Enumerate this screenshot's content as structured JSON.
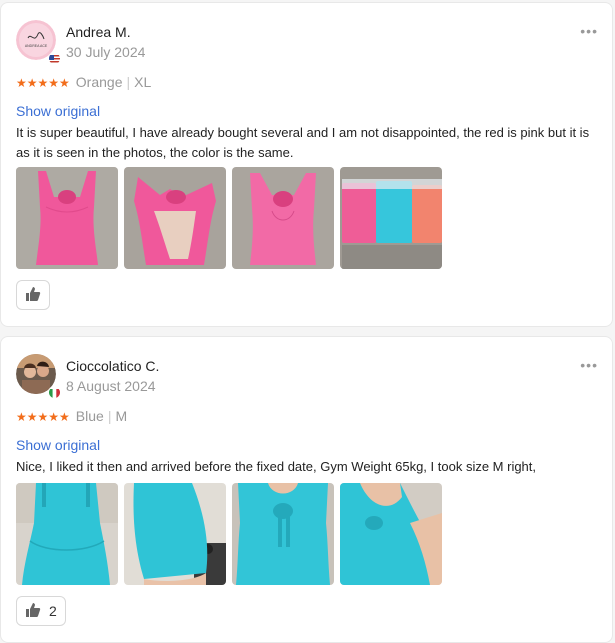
{
  "reviews": [
    {
      "name": "Andrea M.",
      "date": "30 July 2024",
      "stars": "★★★★★",
      "color": "Orange",
      "size": "XL",
      "show_original": "Show original",
      "text": "It is super beautiful, I have already bought several and I am not disappointed, the red is pink but it is as it is seen in the photos, the color is the same.",
      "like_count": "",
      "flag": "us-flag",
      "avatar_text": "ANDREA ACE"
    },
    {
      "name": "Cioccolatico C.",
      "date": "8 August 2024",
      "stars": "★★★★★",
      "color": "Blue",
      "size": "M",
      "show_original": "Show original",
      "text": "Nice, I liked it then and arrived before the fixed date, Gym Weight 65kg, I took size M right,",
      "like_count": "2",
      "flag": "italy-flag"
    }
  ],
  "menu_icon": "•••",
  "separator": "|",
  "colors": {
    "accent": "#f26d1b",
    "link": "#3b6fd4",
    "pink": "#f0589b",
    "turquoise": "#2fc4d6"
  }
}
